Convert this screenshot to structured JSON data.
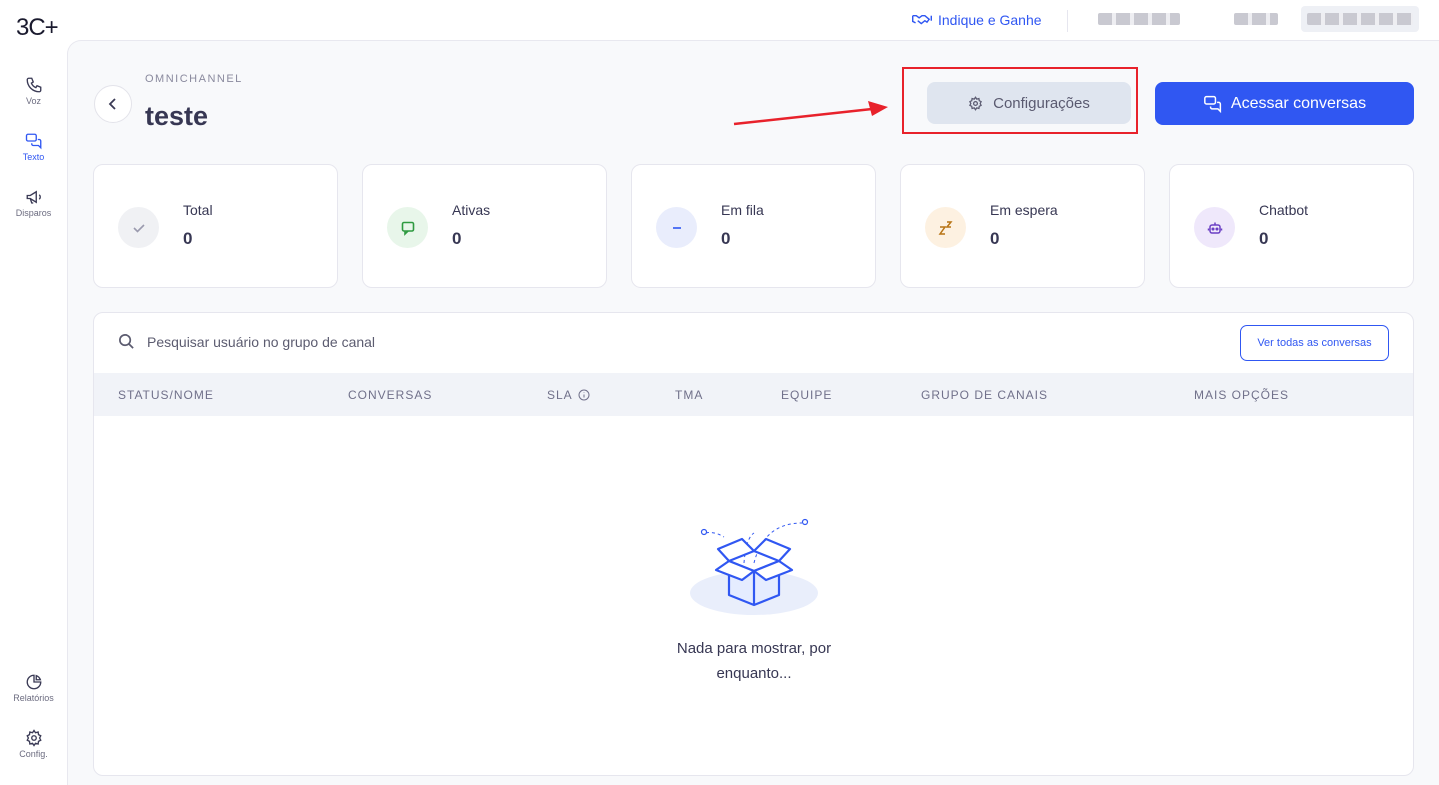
{
  "app": {
    "logo_text": "3C+"
  },
  "sidebar": {
    "items": [
      {
        "label": "Voz",
        "icon": "phone-icon"
      },
      {
        "label": "Texto",
        "icon": "chat-icon",
        "active": true
      },
      {
        "label": "Disparos",
        "icon": "megaphone-icon"
      },
      {
        "label": "Relatórios",
        "icon": "pie-chart-icon"
      },
      {
        "label": "Config.",
        "icon": "gear-icon"
      }
    ]
  },
  "topbar": {
    "refer_label": "Indique e Ganhe",
    "refer_icon": "handshake-icon"
  },
  "header": {
    "eyebrow": "OMNICHANNEL",
    "title": "teste",
    "config_label": "Configurações",
    "access_label": "Acessar conversas"
  },
  "stats": [
    {
      "label": "Total",
      "value": "0",
      "icon": "check-icon",
      "color": "#f0f1f4"
    },
    {
      "label": "Ativas",
      "value": "0",
      "icon": "message-icon",
      "color": "#e8f6ea"
    },
    {
      "label": "Em fila",
      "value": "0",
      "icon": "minus-icon",
      "color": "#e9edfc"
    },
    {
      "label": "Em espera",
      "value": "0",
      "icon": "sleep-icon",
      "color": "#fdf1e1"
    },
    {
      "label": "Chatbot",
      "value": "0",
      "icon": "robot-icon",
      "color": "#efe8fb"
    }
  ],
  "search": {
    "placeholder": "Pesquisar usuário no grupo de canal"
  },
  "table": {
    "view_all_label": "Ver todas as conversas",
    "columns": [
      "STATUS/NOME",
      "CONVERSAS",
      "SLA",
      "TMA",
      "EQUIPE",
      "GRUPO DE CANAIS",
      "MAIS OPÇÕES"
    ]
  },
  "empty": {
    "line1": "Nada para mostrar, por",
    "line2": "enquanto..."
  },
  "colors": {
    "accent": "#3057f2",
    "highlight": "#e8222b"
  }
}
